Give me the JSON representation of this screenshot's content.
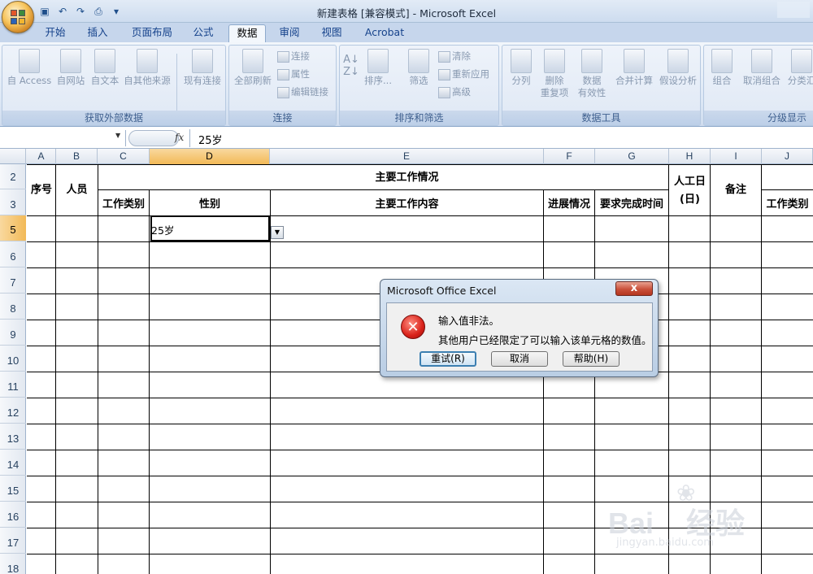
{
  "window": {
    "title": "新建表格  [兼容模式] - Microsoft Excel"
  },
  "qat": {
    "icons": [
      "save-icon",
      "undo-icon",
      "redo-icon",
      "print-preview-icon",
      "customize-icon"
    ]
  },
  "tabs": [
    {
      "label": "开始"
    },
    {
      "label": "插入"
    },
    {
      "label": "页面布局"
    },
    {
      "label": "公式"
    },
    {
      "label": "数据"
    },
    {
      "label": "审阅"
    },
    {
      "label": "视图"
    },
    {
      "label": "Acrobat"
    }
  ],
  "active_tab": "数据",
  "ribbon": {
    "external_data": {
      "label": "获取外部数据",
      "access": "自 Access",
      "web": "自网站",
      "text": "自文本",
      "other": "自其他来源",
      "existing": "现有连接"
    },
    "connections": {
      "label": "连接",
      "refresh_all": "全部刷新",
      "connections": "连接",
      "properties": "属性",
      "edit_links": "编辑链接"
    },
    "sort_filter": {
      "label": "排序和筛选",
      "sort": "排序...",
      "filter": "筛选",
      "clear": "清除",
      "reapply": "重新应用",
      "advanced": "高级"
    },
    "data_tools": {
      "label": "数据工具",
      "text_to_columns": "分列",
      "remove_dup_1": "删除",
      "remove_dup_2": "重复项",
      "validation_1": "数据",
      "validation_2": "有效性",
      "consolidate": "合并计算",
      "what_if": "假设分析"
    },
    "outline": {
      "label": "分级显示",
      "group": "组合",
      "ungroup": "取消组合",
      "subtotal": "分类汇"
    }
  },
  "formula_bar": {
    "name_box": "",
    "fx": "fx",
    "value": "25岁"
  },
  "columns": [
    "A",
    "B",
    "C",
    "D",
    "E",
    "F",
    "G",
    "H",
    "I",
    "J"
  ],
  "selected_column": "D",
  "rows": [
    "2",
    "3",
    "5",
    "6",
    "7",
    "8",
    "9",
    "10",
    "11",
    "12",
    "13",
    "14",
    "15",
    "16",
    "17",
    "18"
  ],
  "selected_row": "5",
  "sheet": {
    "h_seq": "序号",
    "h_person": "人员",
    "h_main": "主要工作情况",
    "h_workhours_1": "人工日",
    "h_workhours_2": "(日)",
    "h_note": "备注",
    "h_worktype": "工作类别",
    "h_gender": "性别",
    "h_content": "主要工作内容",
    "h_progress": "进展情况",
    "h_deadline": "要求完成时间",
    "h_worktype_j": "工作类别",
    "active_cell_value": "25岁"
  },
  "dialog": {
    "title": "Microsoft Office Excel",
    "close": "x",
    "message1": "输入值非法。",
    "message2": "其他用户已经限定了可以输入该单元格的数值。",
    "retry": "重试(R)",
    "cancel": "取消",
    "help": "帮助(H)"
  },
  "watermark": {
    "text": "Bai",
    "text2": "经验",
    "url": "jingyan.baidu.com"
  }
}
